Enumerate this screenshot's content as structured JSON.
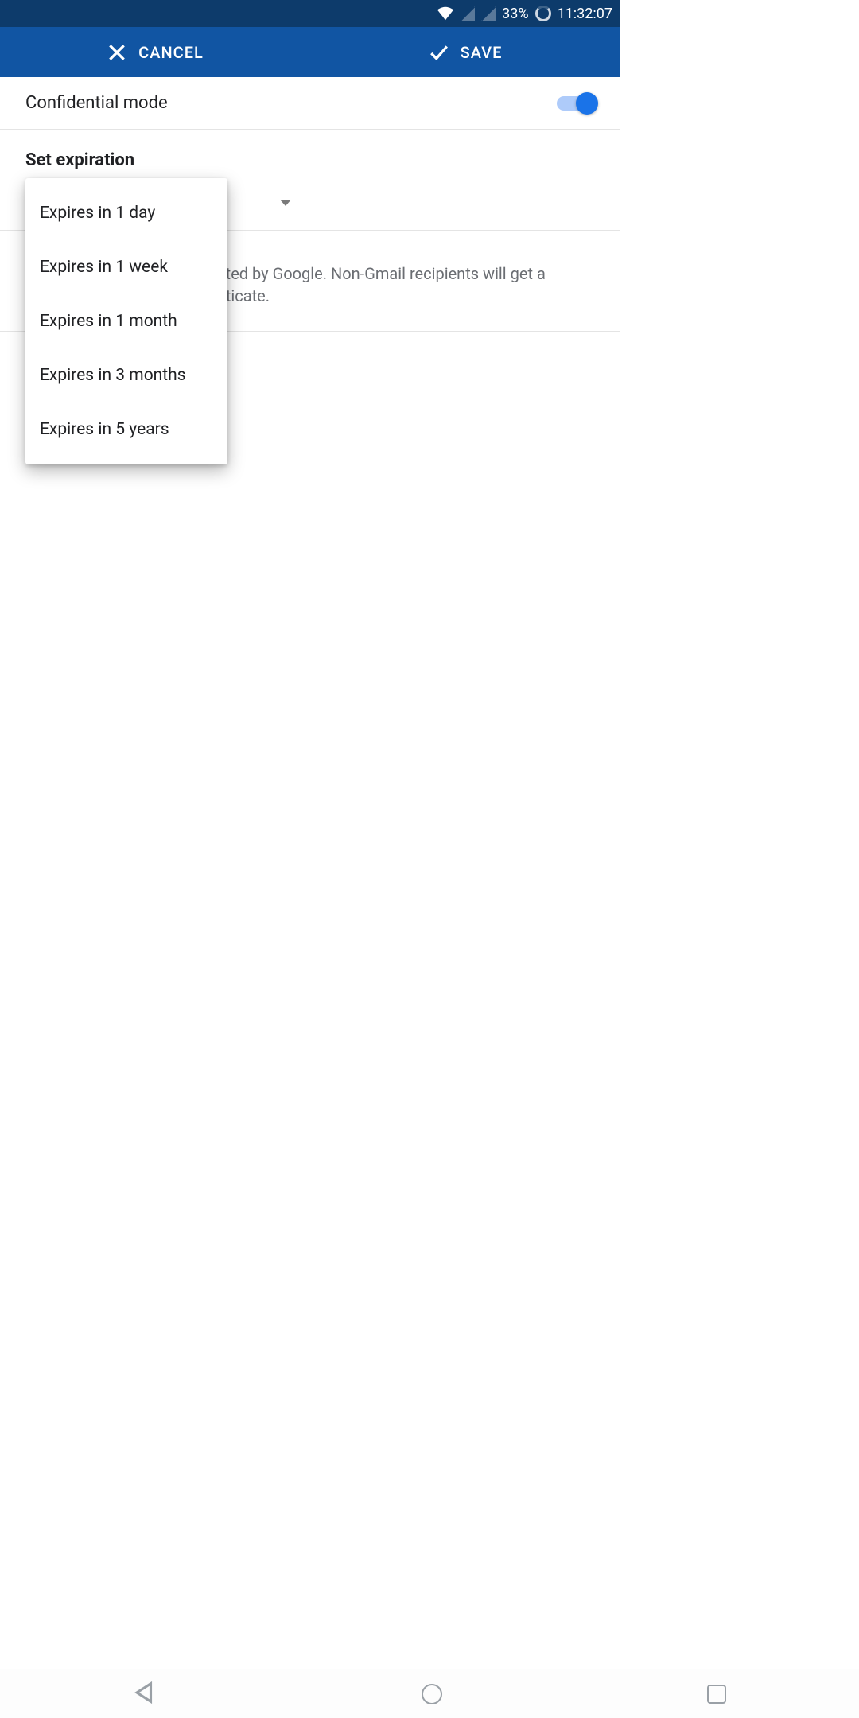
{
  "status": {
    "battery": "33%",
    "time": "11:32:07"
  },
  "app_bar": {
    "cancel": "CANCEL",
    "save": "SAVE"
  },
  "confidential": {
    "label": "Confidential mode",
    "enabled": true
  },
  "expiration": {
    "title": "Set expiration",
    "selected": "Expires in 1 day",
    "options": [
      "Expires in 1 day",
      "Expires in 1 week",
      "Expires in 1 month",
      "Expires in 3 months",
      "Expires in 5 years"
    ]
  },
  "passcode_hint": "All passcodes will be generated by Google. Non-Gmail recipients will get a passcode via SMS to authenticate."
}
